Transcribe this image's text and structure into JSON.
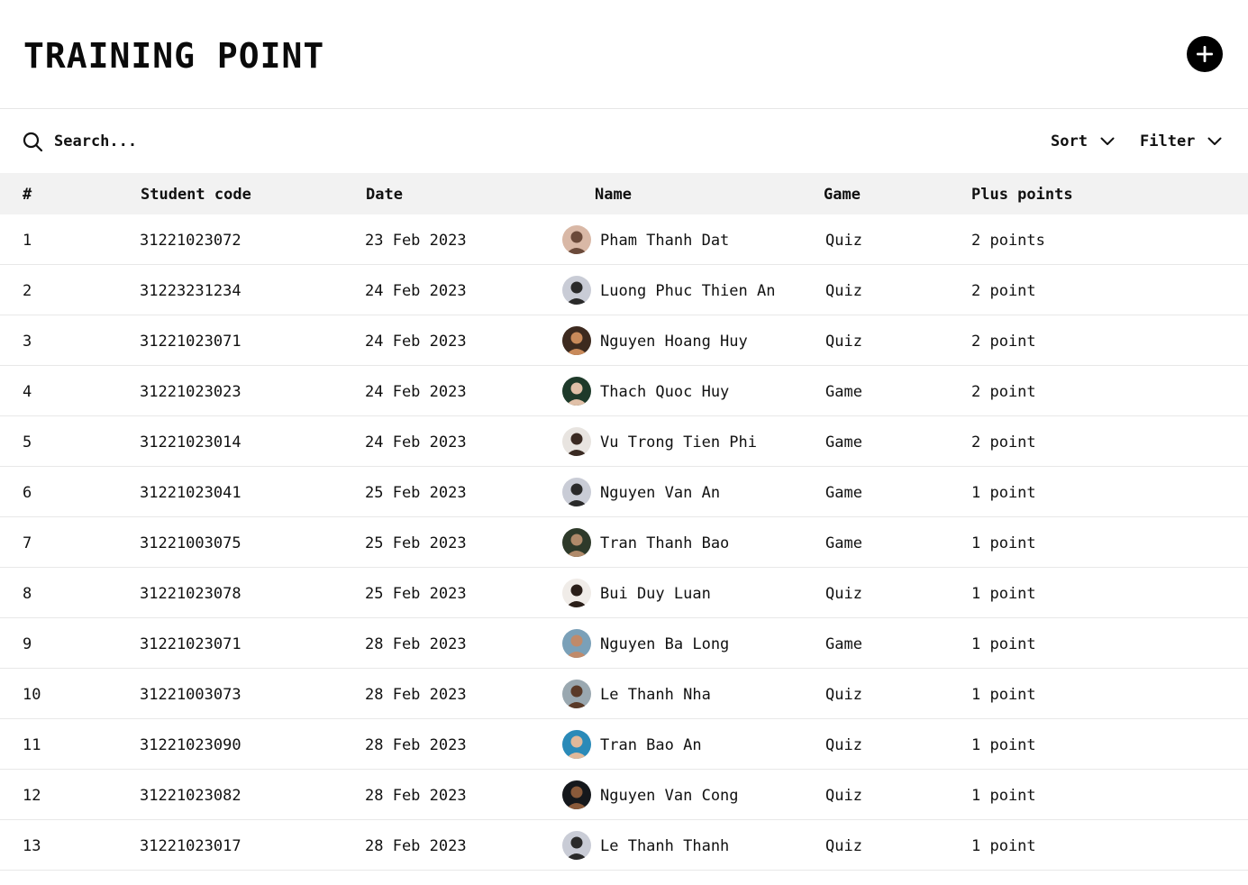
{
  "header": {
    "title": "TRAINING POINT"
  },
  "toolbar": {
    "search_placeholder": "Search...",
    "sort_label": "Sort",
    "filter_label": "Filter"
  },
  "table": {
    "columns": [
      "#",
      "Student code",
      "Date",
      "Name",
      "Game",
      "Plus points"
    ],
    "rows": [
      {
        "num": "1",
        "code": "31221023072",
        "date": "23 Feb 2023",
        "name": "Pham Thanh Dat",
        "game": "Quiz",
        "points": "2 points",
        "avatar_bg": "#d9b8a6",
        "avatar_fg": "#6b4a3a"
      },
      {
        "num": "2",
        "code": "31223231234",
        "date": "24 Feb 2023",
        "name": "Luong Phuc Thien An",
        "game": "Quiz",
        "points": "2 point",
        "avatar_bg": "#c9ccd6",
        "avatar_fg": "#2a2a2a"
      },
      {
        "num": "3",
        "code": "31221023071",
        "date": "24 Feb 2023",
        "name": "Nguyen Hoang Huy",
        "game": "Quiz",
        "points": "2 point",
        "avatar_bg": "#3d2a1f",
        "avatar_fg": "#c98a5a"
      },
      {
        "num": "4",
        "code": "31221023023",
        "date": "24 Feb 2023",
        "name": "Thach Quoc Huy",
        "game": "Game",
        "points": "2 point",
        "avatar_bg": "#1e3a2a",
        "avatar_fg": "#e0c0a8"
      },
      {
        "num": "5",
        "code": "31221023014",
        "date": "24 Feb 2023",
        "name": "Vu Trong Tien Phi",
        "game": "Game",
        "points": "2 point",
        "avatar_bg": "#e8e4e0",
        "avatar_fg": "#3a2a22"
      },
      {
        "num": "6",
        "code": "31221023041",
        "date": "25 Feb 2023",
        "name": "Nguyen Van An",
        "game": "Game",
        "points": "1 point",
        "avatar_bg": "#c9ccd6",
        "avatar_fg": "#2a2a2a"
      },
      {
        "num": "7",
        "code": "31221003075",
        "date": "25 Feb 2023",
        "name": "Tran Thanh Bao",
        "game": "Game",
        "points": "1 point",
        "avatar_bg": "#2e3a2a",
        "avatar_fg": "#b08a6a"
      },
      {
        "num": "8",
        "code": "31221023078",
        "date": "25 Feb 2023",
        "name": "Bui Duy Luan",
        "game": "Quiz",
        "points": "1 point",
        "avatar_bg": "#f0ece8",
        "avatar_fg": "#2a1e18"
      },
      {
        "num": "9",
        "code": "31221023071",
        "date": "28 Feb 2023",
        "name": "Nguyen Ba Long",
        "game": "Game",
        "points": "1 point",
        "avatar_bg": "#7aa0b8",
        "avatar_fg": "#c08a6a"
      },
      {
        "num": "10",
        "code": "31221003073",
        "date": "28 Feb 2023",
        "name": "Le Thanh Nha",
        "game": "Quiz",
        "points": "1 point",
        "avatar_bg": "#9aa8b0",
        "avatar_fg": "#5a3a28"
      },
      {
        "num": "11",
        "code": "31221023090",
        "date": "28 Feb 2023",
        "name": "Tran Bao An",
        "game": "Quiz",
        "points": "1 point",
        "avatar_bg": "#2a8ab8",
        "avatar_fg": "#e0b89a"
      },
      {
        "num": "12",
        "code": "31221023082",
        "date": "28 Feb 2023",
        "name": "Nguyen Van Cong",
        "game": "Quiz",
        "points": "1 point",
        "avatar_bg": "#15181c",
        "avatar_fg": "#8a5a3a"
      },
      {
        "num": "13",
        "code": "31221023017",
        "date": "28 Feb 2023",
        "name": "Le Thanh Thanh",
        "game": "Quiz",
        "points": "1 point",
        "avatar_bg": "#c9ccd6",
        "avatar_fg": "#2a2a2a"
      }
    ]
  },
  "icons": {
    "add": "plus-circle-icon",
    "search": "search-icon",
    "chevron": "chevron-down-icon"
  }
}
